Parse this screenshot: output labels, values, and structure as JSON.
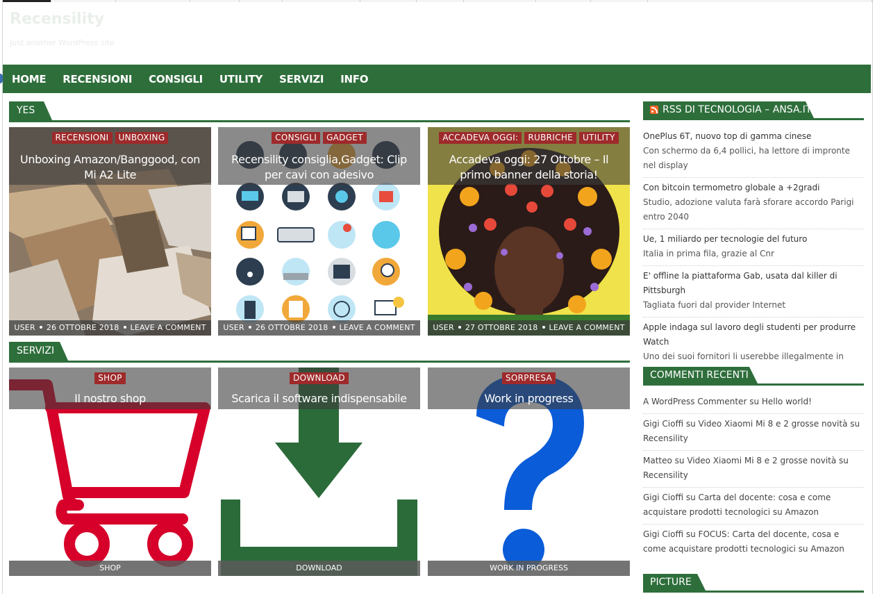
{
  "site": {
    "title": "Recensility",
    "description": "Just another WordPress site"
  },
  "nav": {
    "items": [
      "HOME",
      "RECENSIONI",
      "CONSIGLI",
      "UTILITY",
      "SERVIZI",
      "INFO"
    ]
  },
  "sections": {
    "yes": {
      "label": "YES",
      "posts": [
        {
          "cats": [
            "RECENSIONI",
            "UNBOXING"
          ],
          "title": "Unboxing Amazon/Banggood, con Mi A2 Lite",
          "author": "USER",
          "date": "26 OTTOBRE 2018",
          "comments": "LEAVE A COMMENT"
        },
        {
          "cats": [
            "CONSIGLI",
            "GADGET"
          ],
          "title": "Recensility consiglia,Gadget: Clip per cavi con adesivo",
          "author": "USER",
          "date": "26 OTTOBRE 2018",
          "comments": "LEAVE A COMMENT"
        },
        {
          "cats": [
            "ACCADEVA OGGI:",
            "RUBRICHE",
            "UTILITY"
          ],
          "title": "Accadeva oggi: 27 Ottobre – Il primo banner della storia!",
          "author": "USER",
          "date": "27 OTTOBRE 2018",
          "comments": "LEAVE A COMMENT"
        }
      ]
    },
    "servizi": {
      "label": "SERVIZI",
      "posts": [
        {
          "cat": "SHOP",
          "title": "Il nostro shop",
          "foot": "SHOP"
        },
        {
          "cat": "DOWNLOAD",
          "title": "Scarica il software indispensabile",
          "foot": "DOWNLOAD"
        },
        {
          "cat": "SORPRESA",
          "title": "Work in progress",
          "foot": "WORK IN PROGRESS"
        }
      ]
    }
  },
  "sidebar": {
    "rss": {
      "title": "RSS DI TECNOLOGIA – ANSA.IT",
      "items": [
        {
          "title": "OnePlus 6T, nuovo top di gamma cinese",
          "summary": "Con schermo da 6,4 pollici, ha lettore di impronte nel display"
        },
        {
          "title": "Con bitcoin termometro globale a +2gradi",
          "summary": "Studio, adozione valuta farà sforare accordo Parigi entro 2040"
        },
        {
          "title": "Ue, 1 miliardo per tecnologie del futuro",
          "summary": "Italia in prima fila, grazie al Cnr"
        },
        {
          "title": "E' offline la piattaforma Gab, usata dal killer di Pittsburgh",
          "summary": "Tagliata fuori dal provider Internet"
        },
        {
          "title": "Apple indaga sul lavoro degli studenti per produrre Watch",
          "summary": "Uno dei suoi fornitori li userebbe illegalmente in Cina"
        }
      ]
    },
    "comments": {
      "title": "COMMENTI RECENTI",
      "items": [
        "A WordPress Commenter su Hello world!",
        "Gigi Cioffi su Video Xiaomi Mi 8 e 2 grosse novità su Recensility",
        "Matteo su Video Xiaomi Mi 8 e 2 grosse novità su Recensility",
        "Gigi Cioffi su Carta del docente: cosa e come acquistare prodotti tecnologici su Amazon",
        "Gigi Cioffi su FOCUS: Carta del docente, cosa e come acquistare prodotti tecnologici su Amazon"
      ]
    },
    "picture": {
      "title": "PICTURE"
    }
  },
  "colors": {
    "brand_green": "#2e6e3b",
    "category_red": "#9e2a2b"
  }
}
